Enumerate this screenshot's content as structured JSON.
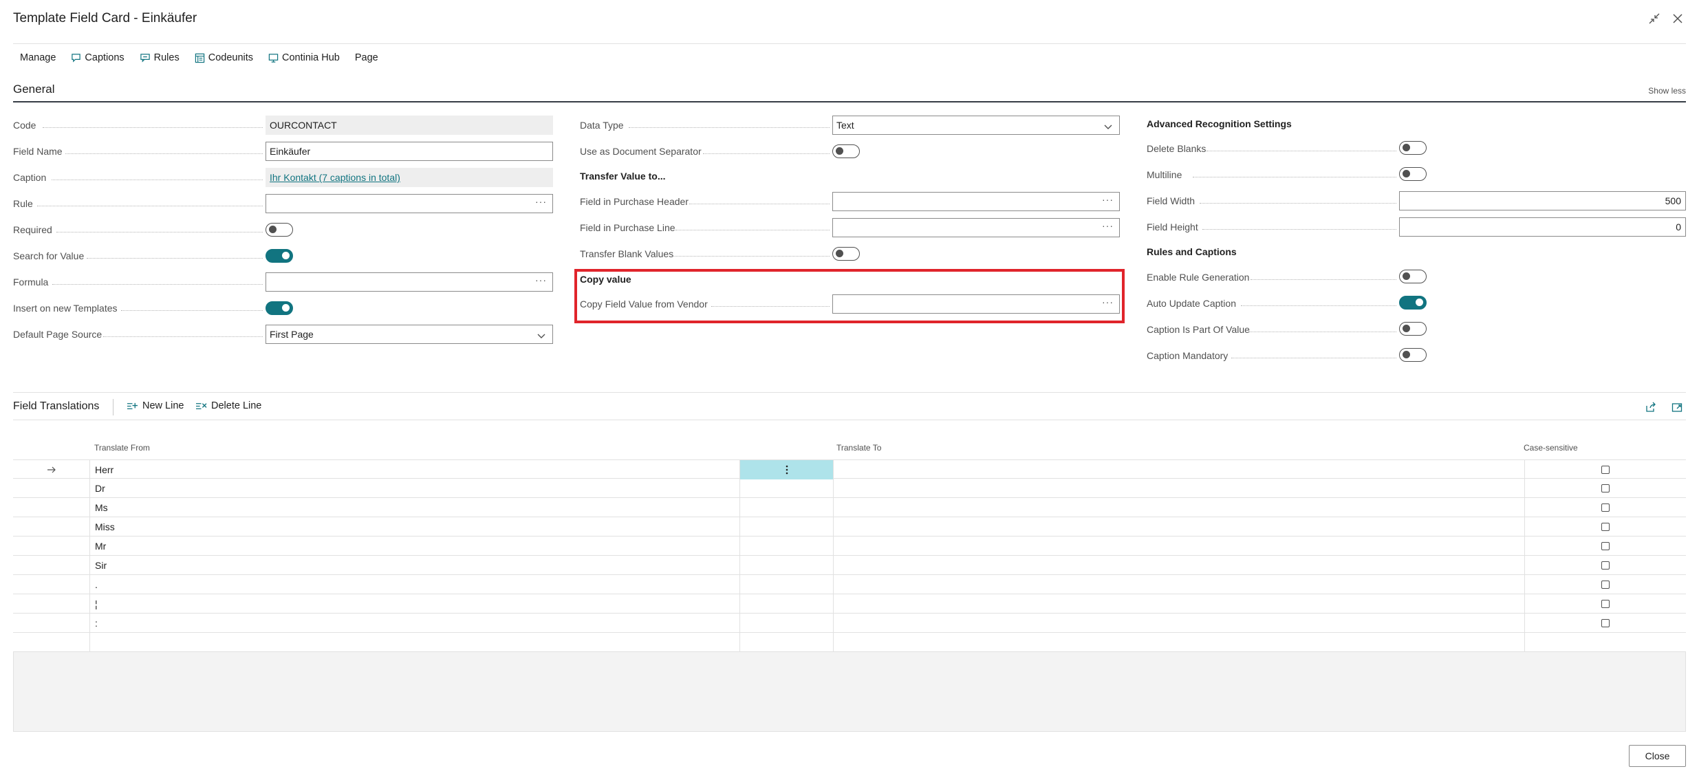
{
  "window": {
    "title": "Template Field Card - Einkäufer"
  },
  "actions": [
    "Manage",
    "Captions",
    "Rules",
    "Codeunits",
    "Continia Hub",
    "Page"
  ],
  "general": {
    "title": "General",
    "show_less": "Show less",
    "col1": {
      "code_label": "Code",
      "code_value": "OURCONTACT",
      "field_name_label": "Field Name",
      "field_name_value": "Einkäufer",
      "caption_label": "Caption",
      "caption_value": "Ihr Kontakt (7 captions in total)",
      "rule_label": "Rule",
      "required_label": "Required",
      "search_label": "Search for Value",
      "formula_label": "Formula",
      "insert_label": "Insert on new Templates",
      "page_source_label": "Default Page Source",
      "page_source_value": "First Page"
    },
    "col2": {
      "data_type_label": "Data Type",
      "data_type_value": "Text",
      "separator_label": "Use as Document Separator",
      "transfer_group": "Transfer Value to...",
      "purchase_header_label": "Field in Purchase Header",
      "purchase_line_label": "Field in Purchase Line",
      "transfer_blank_label": "Transfer Blank Values",
      "copy_group": "Copy value",
      "copy_vendor_label": "Copy Field Value from Vendor"
    },
    "col3": {
      "adv_group": "Advanced Recognition Settings",
      "delete_blanks_label": "Delete Blanks",
      "multiline_label": "Multiline",
      "width_label": "Field Width",
      "width_value": "500",
      "height_label": "Field Height",
      "height_value": "0",
      "rules_group": "Rules and Captions",
      "enable_rule_label": "Enable Rule Generation",
      "auto_caption_label": "Auto Update Caption",
      "caption_part_label": "Caption Is Part Of Value",
      "caption_mandatory_label": "Caption Mandatory"
    },
    "toggles": {
      "required": false,
      "search": true,
      "insert": true,
      "separator": false,
      "transfer_blank": false,
      "delete_blanks": false,
      "multiline": false,
      "enable_rule": false,
      "auto_caption": true,
      "caption_part": false,
      "caption_mandatory": false
    }
  },
  "translations": {
    "title": "Field Translations",
    "new_line": "New Line",
    "delete_line": "Delete Line",
    "columns": {
      "from": "Translate From",
      "to": "Translate To",
      "case": "Case-sensitive"
    },
    "rows": [
      {
        "from": "Herr",
        "to": "",
        "case": false
      },
      {
        "from": "Dr",
        "to": "",
        "case": false
      },
      {
        "from": "Ms",
        "to": "",
        "case": false
      },
      {
        "from": "Miss",
        "to": "",
        "case": false
      },
      {
        "from": "Mr",
        "to": "",
        "case": false
      },
      {
        "from": "Sir",
        "to": "",
        "case": false
      },
      {
        "from": ".",
        "to": "",
        "case": false
      },
      {
        "from": "¦",
        "to": "",
        "case": false
      },
      {
        "from": ":",
        "to": "",
        "case": false
      }
    ]
  },
  "footer": {
    "close_label": "Close"
  },
  "colors": {
    "accent": "#117480",
    "highlight": "#e0242b",
    "selected_cell": "#aee3ea"
  }
}
